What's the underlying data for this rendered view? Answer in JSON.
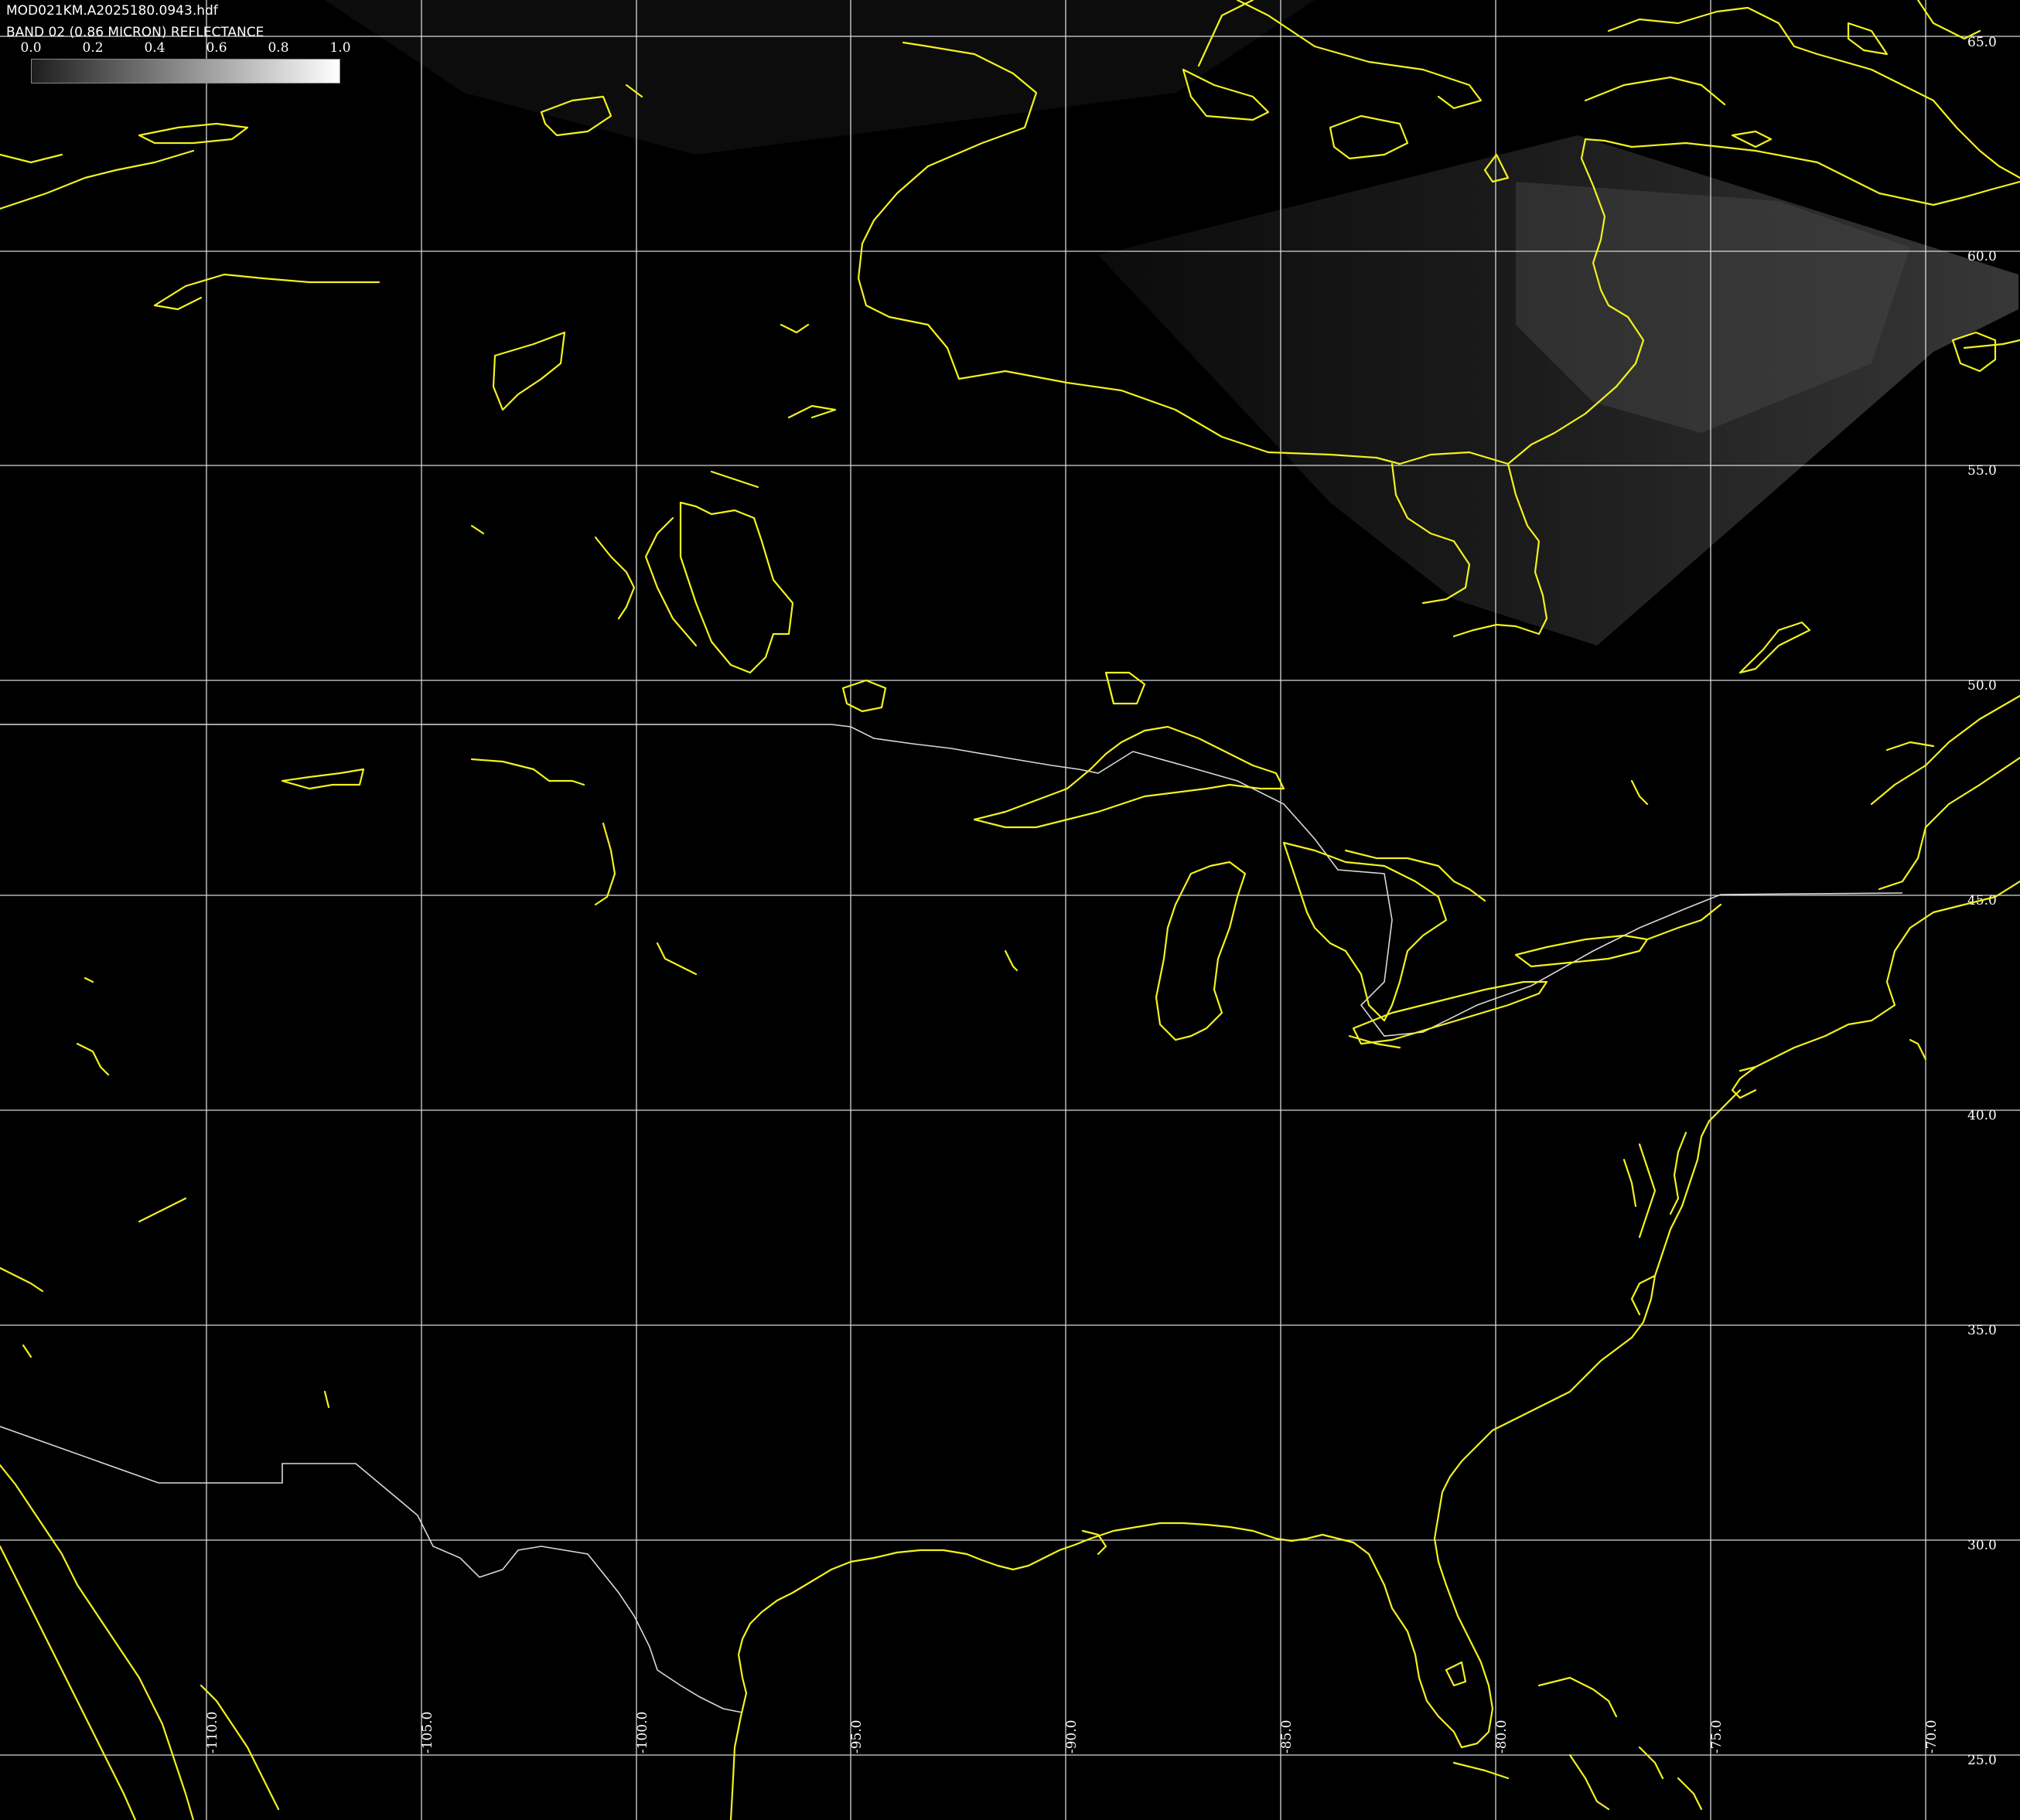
{
  "header": {
    "file_title": "MOD021KM.A2025180.0943.hdf",
    "band_title": "BAND 02 (0.86 MICRON) REFLECTANCE"
  },
  "colorbar": {
    "ticks": [
      "0.0",
      "0.2",
      "0.4",
      "0.6",
      "0.8",
      "1.0"
    ],
    "range": [
      0.0,
      1.0
    ],
    "color_low": "#1e1e1e",
    "color_high": "#ffffff"
  },
  "grid": {
    "lat_labels": [
      "65.0",
      "60.0",
      "55.0",
      "50.0",
      "45.0",
      "40.0",
      "35.0",
      "30.0",
      "25.0"
    ],
    "lon_labels": [
      "-110.0",
      "-105.0",
      "-100.0",
      "-95.0",
      "-90.0",
      "-85.0",
      "-80.0",
      "-75.0",
      "-70.0"
    ]
  },
  "style": {
    "background": "#000000",
    "coastline_color": "#f2f21e",
    "gridline_color": "#d8d8d8",
    "border_color": "#d9d9d9",
    "swath_color": "#2e2e2e"
  }
}
